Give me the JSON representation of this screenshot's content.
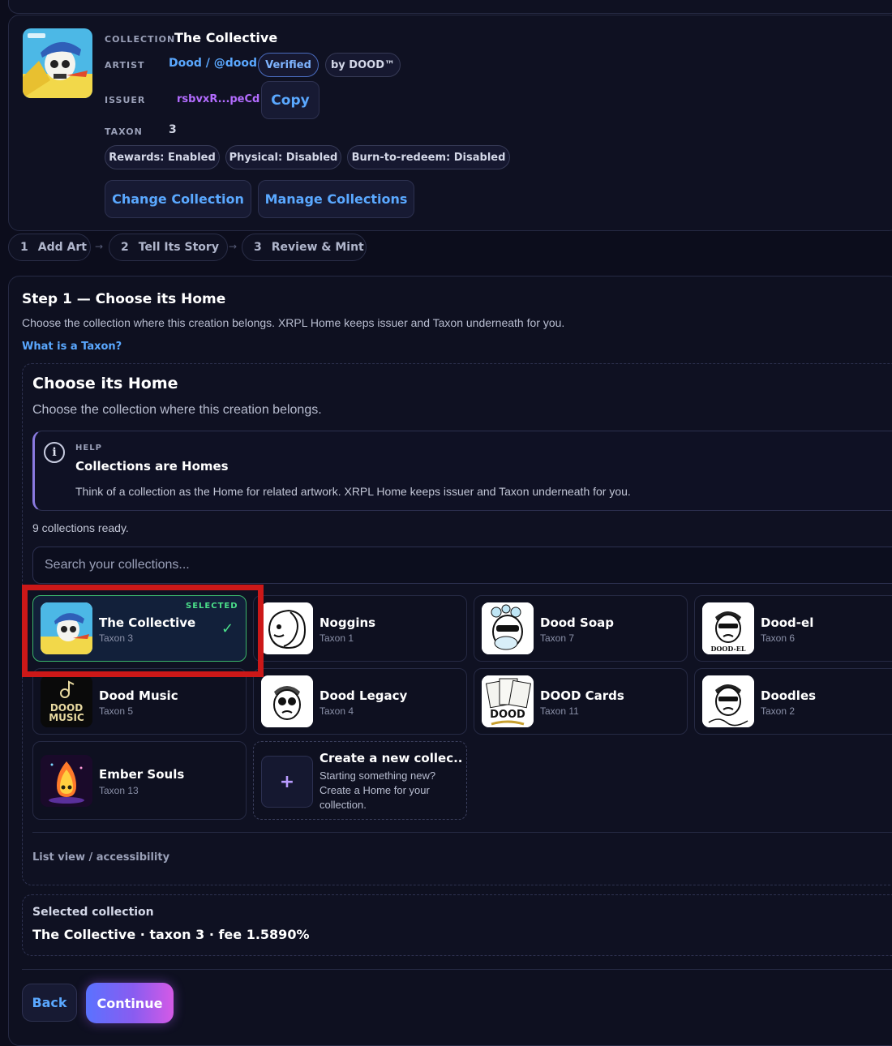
{
  "collection": {
    "label": "COLLECTION",
    "name": "The Collective",
    "artist_label": "ARTIST",
    "artist": "Dood / @dood",
    "verified": "Verified",
    "by": "by DOOD™",
    "issuer_label": "ISSUER",
    "issuer": "rsbvxR...peCd",
    "copy": "Copy",
    "taxon_label": "TAXON",
    "taxon": "3",
    "badges": [
      "Rewards: Enabled",
      "Physical: Disabled",
      "Burn-to-redeem: Disabled"
    ],
    "change_button": "Change Collection",
    "manage_button": "Manage Collections"
  },
  "steps": [
    {
      "num": "1",
      "label": "Add Art"
    },
    {
      "num": "2",
      "label": "Tell Its Story"
    },
    {
      "num": "3",
      "label": "Review & Mint"
    }
  ],
  "step_arrow": "→",
  "step1": {
    "title": "Step 1 — Choose its Home",
    "desc": "Choose the collection where this creation belongs. XRPL Home keeps issuer and Taxon underneath for you.",
    "taxon_link": "What is a Taxon?"
  },
  "home": {
    "title": "Choose its Home",
    "subtitle": "Choose the collection where this creation belongs."
  },
  "help": {
    "icon": "info-icon",
    "label": "HELP",
    "title": "Collections are Homes",
    "text": "Think of a collection as the Home for related artwork. XRPL Home keeps issuer and Taxon underneath for you."
  },
  "ready": "9 collections ready.",
  "search": {
    "placeholder": "Search your collections..."
  },
  "selected_badge": "SELECTED",
  "check": "✓",
  "tiles": [
    {
      "name": "The Collective",
      "taxon": "Taxon 3"
    },
    {
      "name": "Noggins",
      "taxon": "Taxon 1"
    },
    {
      "name": "Dood Soap",
      "taxon": "Taxon 7"
    },
    {
      "name": "Dood-el",
      "taxon": "Taxon 6"
    },
    {
      "name": "Dood Music",
      "taxon": "Taxon 5"
    },
    {
      "name": "Dood Legacy",
      "taxon": "Taxon 4"
    },
    {
      "name": "DOOD Cards",
      "taxon": "Taxon 11"
    },
    {
      "name": "Doodles",
      "taxon": "Taxon 2"
    },
    {
      "name": "Ember Souls",
      "taxon": "Taxon 13"
    }
  ],
  "new_tile": {
    "title": "Create a new collec...",
    "desc": "Starting something new? Create a Home for your collection.",
    "icon": "plus-icon",
    "plus": "+"
  },
  "art_text": {
    "music": "DOOD\nMUSIC",
    "cards": "DOOD",
    "dood_el": "DOOD-EL"
  },
  "list_view": "List view / accessibility",
  "selected": {
    "label": "Selected collection",
    "summary": "The Collective · taxon 3 · fee 1.5890%"
  },
  "buttons": {
    "back": "Back",
    "continue": "Continue"
  },
  "colors": {
    "accent_blue": "#5aa8ff",
    "selected_green": "#3bb56b",
    "highlight_red": "#cc1818",
    "issuer_purple": "#b36cff"
  }
}
